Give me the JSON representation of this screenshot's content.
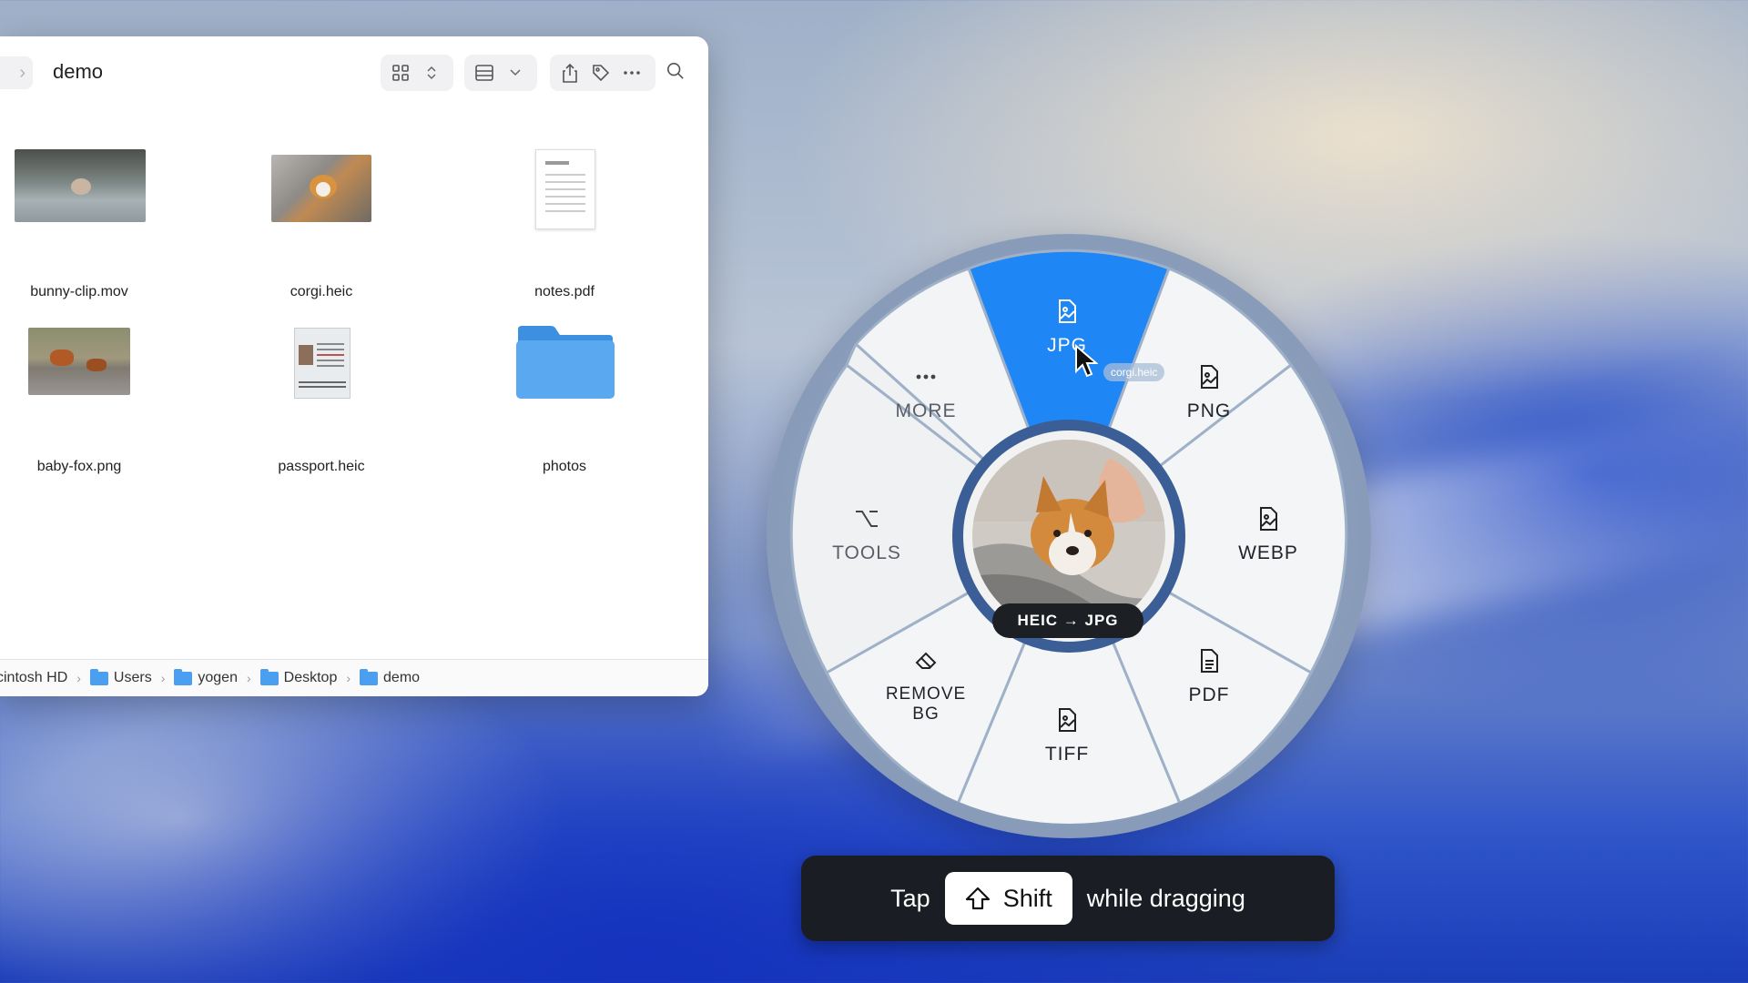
{
  "finder": {
    "title": "demo",
    "files": [
      {
        "name": "bunny-clip.mov"
      },
      {
        "name": "corgi.heic"
      },
      {
        "name": "notes.pdf"
      },
      {
        "name": "baby-fox.png"
      },
      {
        "name": "passport.heic"
      },
      {
        "name": "photos"
      }
    ],
    "path": [
      "cintosh HD",
      "Users",
      "yogen",
      "Desktop",
      "demo"
    ]
  },
  "radial": {
    "segments": {
      "jpg": "JPG",
      "png": "PNG",
      "webp": "WEBP",
      "pdf": "PDF",
      "tiff": "TIFF",
      "remove_bg_line1": "REMOVE",
      "remove_bg_line2": "BG",
      "tools": "TOOLS",
      "more": "MORE"
    },
    "active_segment": "JPG",
    "conversion": "HEIC → JPG",
    "drag_chip": "corgi.heic",
    "accent_color": "#1f86f5"
  },
  "hint": {
    "before": "Tap",
    "key": "Shift",
    "after": "while dragging"
  }
}
